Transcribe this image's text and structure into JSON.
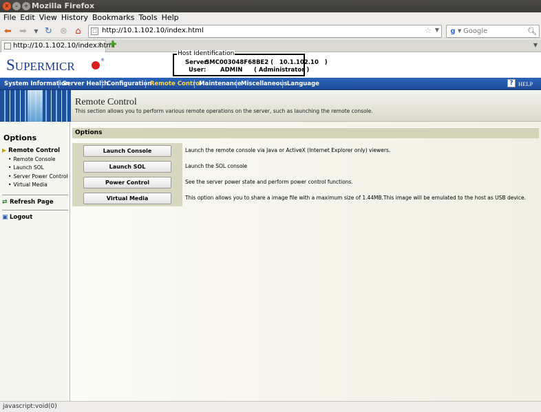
{
  "window": {
    "title": "Mozilla Firefox",
    "close_glyph": "×",
    "min_glyph": "–",
    "max_glyph": "+"
  },
  "menubar": [
    "File",
    "Edit",
    "View",
    "History",
    "Bookmarks",
    "Tools",
    "Help"
  ],
  "navbar": {
    "url": "http://10.1.102.10/index.html",
    "search_placeholder": "Google"
  },
  "tab": {
    "label": "http://10.1.102.10/index.html"
  },
  "header": {
    "logo_big_s": "S",
    "logo_rest": "UPERMICR",
    "logo_reg": "®",
    "host_legend": "Host Identification",
    "server_label": "Server:",
    "server_value": "SMC003048F68BE2 (   10.1.102.10   )",
    "user_label": "User:",
    "user_value": "ADMIN",
    "user_role": "( Administrator )"
  },
  "mainnav": {
    "items": [
      "System Information",
      "Server Health",
      "Configuration",
      "Remote Control",
      "Maintenance",
      "Miscellaneous",
      "Language"
    ],
    "help": "HELP"
  },
  "banner": {
    "title": "Remote Control",
    "description": "This section allows you to perform various remote operations on the server, such as launching the remote console."
  },
  "sidebar": {
    "title": "Options",
    "section": "Remote Control",
    "subitems": [
      "Remote Console",
      "Launch SOL",
      "Server Power Control",
      "Virtual Media"
    ],
    "refresh": "Refresh Page",
    "logout": "Logout"
  },
  "content": {
    "header": "Options",
    "rows": [
      {
        "button": "Launch Console",
        "description": "Launch the remote console via Java or ActiveX (Internet Explorer only) viewers."
      },
      {
        "button": "Launch SOL",
        "description": "Launch the SOL console"
      },
      {
        "button": "Power Control",
        "description": "See the server power state and perform power control functions."
      },
      {
        "button": "Virtual Media",
        "description": "This option allows you to share a image file with a maximum size of 1.44MB.This image will be emulated to the host as USB device."
      }
    ]
  },
  "statusbar": {
    "text": "javascript:void(0)"
  }
}
